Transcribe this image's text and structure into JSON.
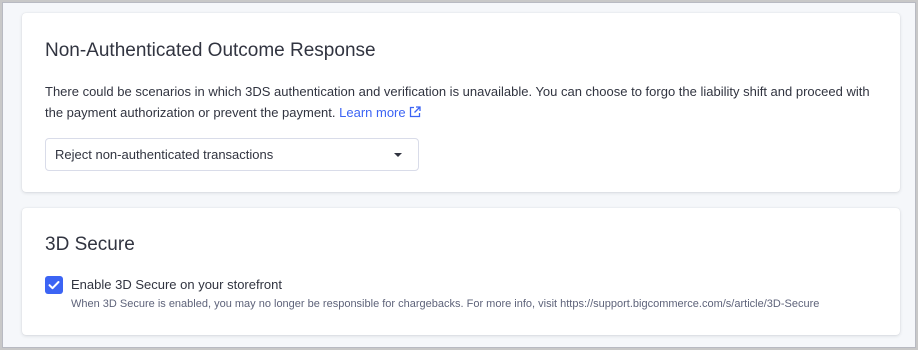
{
  "outcome_section": {
    "title": "Non-Authenticated Outcome Response",
    "description": "There could be scenarios in which 3DS authentication and verification is unavailable. You can choose to forgo the liability shift and proceed with the payment authorization or prevent the payment.",
    "learn_more": "Learn more",
    "select": {
      "value": "Reject non-authenticated transactions"
    }
  },
  "secure_section": {
    "title": "3D Secure",
    "checkbox": {
      "checked": true,
      "label": "Enable 3D Secure on your storefront",
      "description": "When 3D Secure is enabled, you may no longer be responsible for chargebacks. For more info, visit https://support.bigcommerce.com/s/article/3D-Secure"
    }
  },
  "colors": {
    "accent": "#3c64f4",
    "text": "#313440",
    "muted": "#5e637a",
    "background": "#f5f7fa"
  },
  "icons": [
    "external-link-icon",
    "caret-down-icon",
    "checkmark-icon"
  ]
}
